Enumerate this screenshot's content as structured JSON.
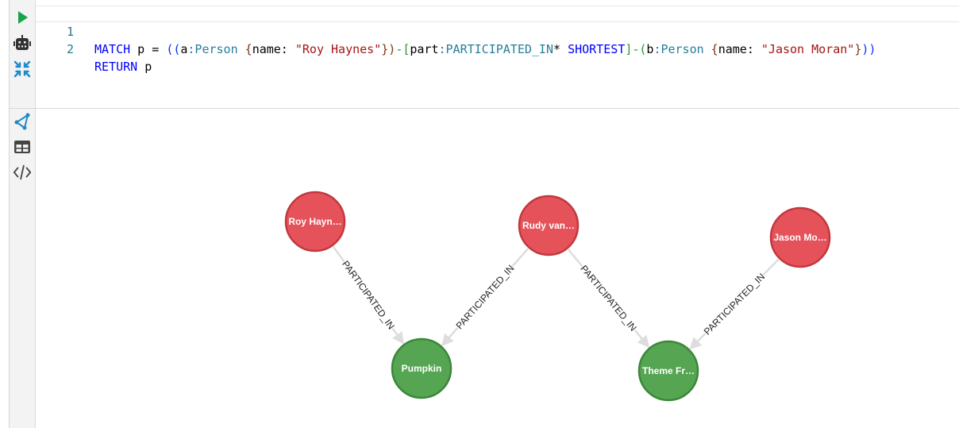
{
  "sidebar": {
    "top_icons": [
      "play-icon",
      "robot-icon",
      "collapse-icon"
    ],
    "bottom_icons": [
      "graph-view-icon",
      "table-view-icon",
      "code-view-icon"
    ],
    "accent": "#1e88c9",
    "run_color": "#16a34a"
  },
  "editor": {
    "line_numbers": [
      "1",
      "2"
    ],
    "line1": {
      "t1": "MATCH",
      "t2": " p = ",
      "t3": "((",
      "t4": "a",
      "t5": ":Person",
      "t6": " {",
      "t7": "name: ",
      "t8": "\"Roy Haynes\"",
      "t9": "})",
      "t10": "-[",
      "t11": "part",
      "t12": ":PARTICIPATED_IN",
      "t13": "* ",
      "t14": "SHORTEST",
      "t15": "]-",
      "t16": "(",
      "t17": "b",
      "t18": ":Person",
      "t19": " {",
      "t20": "name: ",
      "t21": "\"Jason Moran\"",
      "t22": "}",
      "t23": "))"
    },
    "line2": {
      "t1": "RETURN",
      "t2": " p"
    }
  },
  "graph": {
    "colors": {
      "person": "#e5525a",
      "person_stroke": "#c2383f",
      "recording": "#55a553",
      "recording_stroke": "#3b873a",
      "edge": "#dddddd"
    },
    "nodes": [
      {
        "id": "roy",
        "label": "Roy Hayn…",
        "kind": "person"
      },
      {
        "id": "rudy",
        "label": "Rudy van…",
        "kind": "person"
      },
      {
        "id": "jason",
        "label": "Jason Mo…",
        "kind": "person"
      },
      {
        "id": "pumpkin",
        "label": "Pumpkin",
        "kind": "recording"
      },
      {
        "id": "theme",
        "label": "Theme Fr…",
        "kind": "recording"
      }
    ],
    "edges": [
      {
        "from": "roy",
        "to": "pumpkin",
        "label": "PARTICIPATED_IN"
      },
      {
        "from": "rudy",
        "to": "pumpkin",
        "label": "PARTICIPATED_IN"
      },
      {
        "from": "rudy",
        "to": "theme",
        "label": "PARTICIPATED_IN"
      },
      {
        "from": "jason",
        "to": "theme",
        "label": "PARTICIPATED_IN"
      }
    ]
  }
}
